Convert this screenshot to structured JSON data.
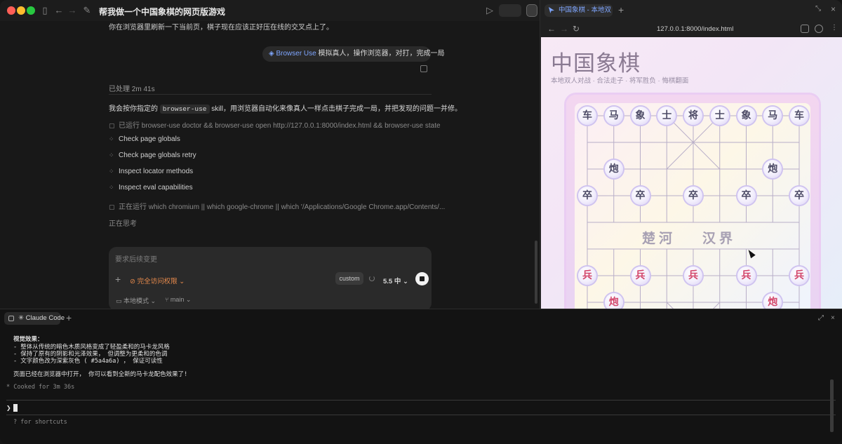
{
  "app": {
    "title": "帮我做一个中国象棋的网页版游戏",
    "more": "···"
  },
  "chat": {
    "intro_line": "你在浏览器里刷新一下当前页，棋子现在应该正好压在线的交叉点上了。",
    "user_bubble": {
      "tag": "Browser Use",
      "text": "模拟真人，操作浏览器，对打，完成一局"
    },
    "processed": "已处理 2m 41s",
    "para_prefix": "我会按你指定的",
    "para_code": "browser-use",
    "para_suffix": "skill，用浏览器自动化来像真人一样点击棋子完成一局，并把发现的问题一并修。",
    "steps": [
      {
        "icon": "terminal-icon",
        "text": "已运行 browser-use doctor && browser-use open http://127.0.0.1:8000/index.html && browser-use state",
        "dim": true
      },
      {
        "icon": "tool-icon",
        "text": "Check page globals",
        "dim": false
      },
      {
        "icon": "tool-icon",
        "text": "Check page globals retry",
        "dim": false
      },
      {
        "icon": "tool-icon",
        "text": "Inspect locator methods",
        "dim": false
      },
      {
        "icon": "tool-icon",
        "text": "Inspect eval capabilities",
        "dim": false
      },
      {
        "icon": "terminal-icon",
        "text": "正在运行 which chromium || which google-chrome || which '/Applications/Google Chrome.app/Contents/...",
        "dim": true
      }
    ],
    "thinking": "正在思考",
    "composer": {
      "placeholder": "要求后续变更",
      "permission": "完全访问权限",
      "custom": "custom",
      "model": "5.5 中"
    },
    "bottom": {
      "mode": "本地模式",
      "branch": "main"
    }
  },
  "browser": {
    "tab_title": "中国象棋 - 本地双",
    "url": "127.0.0.1:8000/index.html",
    "page": {
      "title": "中国象棋",
      "subtitle": "本地双人对战 · 合法走子 · 将军胜负 · 悔棋翻面",
      "river_left": "楚河",
      "river_right": "汉界",
      "black_back_row": [
        "车",
        "马",
        "象",
        "士",
        "将",
        "士",
        "象",
        "马",
        "车"
      ],
      "black_cannon": "炮",
      "black_soldier": "卒",
      "red_soldier": "兵",
      "red_cannon": "炮"
    }
  },
  "terminal": {
    "tab": "Claude Code",
    "lines": [
      {
        "text": "视觉效果：",
        "style": "b"
      },
      {
        "text": "- 整体从传统的暗色木质风格变成了轻盈柔和的马卡龙风格",
        "style": ""
      },
      {
        "text": "- 保持了原有的阴影和光泽效果， 但调整为更柔和的色调",
        "style": ""
      },
      {
        "text": "- 文字颜色改为深紫灰色 ( #5a4a6a) ， 保证可读性",
        "style": ""
      },
      {
        "text": "",
        "style": ""
      },
      {
        "text": "页面已经在浏览器中打开， 你可以看到全新的马卡龙配色效果了!",
        "style": ""
      },
      {
        "text": "",
        "style": ""
      },
      {
        "text": "* Cooked for 3m 36s",
        "style": "dim"
      }
    ],
    "prompt_symbol": "❯",
    "hint": "? for shortcuts"
  },
  "colors": {
    "accent": "#7fa6ff",
    "permission": "#e78a4c",
    "red_piece": "#d2456a",
    "black_piece": "#4c4a66"
  }
}
